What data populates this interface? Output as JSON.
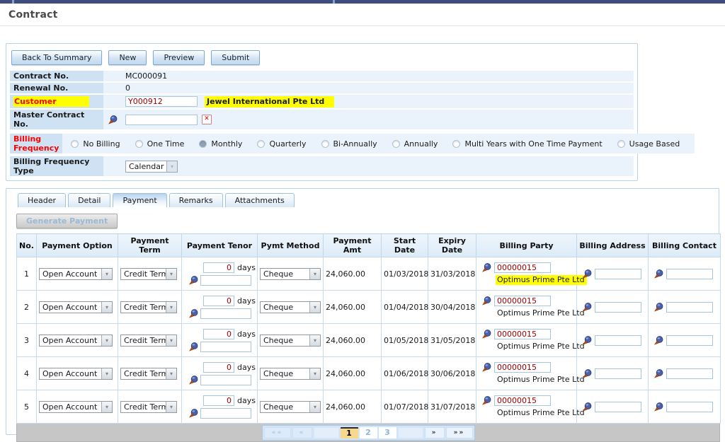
{
  "page": {
    "title": "Contract"
  },
  "toolbar": {
    "buttons": [
      {
        "label": "Back To Summary"
      },
      {
        "label": "New"
      },
      {
        "label": "Preview"
      },
      {
        "label": "Submit"
      }
    ]
  },
  "form": {
    "contract_no": {
      "label": "Contract No.",
      "value": "MC000091"
    },
    "renewal_no": {
      "label": "Renewal No.",
      "value": "0"
    },
    "customer": {
      "label": "Customer",
      "code": "Y000912",
      "name": "Jewel International Pte Ltd"
    },
    "master_contract_no": {
      "label": "Master Contract No.",
      "value": "",
      "clear_glyph": "✕"
    },
    "billing_frequency": {
      "label": "Billing Frequency",
      "selected": "Monthly",
      "options": [
        {
          "label": "No Billing"
        },
        {
          "label": "One Time"
        },
        {
          "label": "Monthly",
          "checked": true
        },
        {
          "label": "Quarterly"
        },
        {
          "label": "Bi-Annually"
        },
        {
          "label": "Annually"
        },
        {
          "label": "Multi Years with One Time Payment"
        },
        {
          "label": "Usage Based"
        }
      ]
    },
    "billing_frequency_type": {
      "label": "Billing Frequency Type",
      "value": "Calendar"
    }
  },
  "tabs": [
    {
      "label": "Header"
    },
    {
      "label": "Detail"
    },
    {
      "label": "Payment",
      "active": true
    },
    {
      "label": "Remarks"
    },
    {
      "label": "Attachments"
    }
  ],
  "payment_tab": {
    "generate_button": "Generate Payment"
  },
  "table": {
    "columns": [
      {
        "label": "No."
      },
      {
        "label": "Payment Option"
      },
      {
        "label": "Payment Term"
      },
      {
        "label": "Payment Tenor"
      },
      {
        "label": "Pymt Method"
      },
      {
        "label": "Payment Amt"
      },
      {
        "label": "Start Date"
      },
      {
        "label": "Expiry Date"
      },
      {
        "label": "Billing Party"
      },
      {
        "label": "Billing Address"
      },
      {
        "label": "Billing Contact"
      }
    ],
    "tenor_unit": "days",
    "rows": [
      {
        "no": "1",
        "payment_option": "Open Account",
        "payment_term": "Credit Term",
        "tenor_days": "0",
        "pymt_method": "Cheque",
        "payment_amt": "24,060.00",
        "start_date": "01/03/2018",
        "expiry_date": "31/03/2018",
        "billing_party_code": "00000015",
        "billing_party_name": "Optimus Prime Pte Ltd",
        "party_highlight": true
      },
      {
        "no": "2",
        "payment_option": "Open Account",
        "payment_term": "Credit Term",
        "tenor_days": "0",
        "pymt_method": "Cheque",
        "payment_amt": "24,060.00",
        "start_date": "01/04/2018",
        "expiry_date": "30/04/2018",
        "billing_party_code": "00000015",
        "billing_party_name": "Optimus Prime Pte Ltd",
        "party_highlight": false
      },
      {
        "no": "3",
        "payment_option": "Open Account",
        "payment_term": "Credit Term",
        "tenor_days": "0",
        "pymt_method": "Cheque",
        "payment_amt": "24,060.00",
        "start_date": "01/05/2018",
        "expiry_date": "31/05/2018",
        "billing_party_code": "00000015",
        "billing_party_name": "Optimus Prime Pte Ltd",
        "party_highlight": false
      },
      {
        "no": "4",
        "payment_option": "Open Account",
        "payment_term": "Credit Term",
        "tenor_days": "0",
        "pymt_method": "Cheque",
        "payment_amt": "24,060.00",
        "start_date": "01/06/2018",
        "expiry_date": "30/06/2018",
        "billing_party_code": "00000015",
        "billing_party_name": "Optimus Prime Pte Ltd",
        "party_highlight": false
      },
      {
        "no": "5",
        "payment_option": "Open Account",
        "payment_term": "Credit Term",
        "tenor_days": "0",
        "pymt_method": "Cheque",
        "payment_amt": "24,060.00",
        "start_date": "01/07/2018",
        "expiry_date": "31/07/2018",
        "billing_party_code": "00000015",
        "billing_party_name": "Optimus Prime Pte Ltd",
        "party_highlight": false
      }
    ]
  },
  "pagination": {
    "first": "««",
    "prev": "«",
    "pages": [
      {
        "label": "1",
        "current": true
      },
      {
        "label": "2",
        "current": false
      },
      {
        "label": "3",
        "current": false
      }
    ],
    "next": "»",
    "last": "»»"
  },
  "colors": {
    "highlight_yellow": "#ffff00",
    "value_red": "#a00000",
    "label_red": "#ff0000",
    "panel_border": "#b9d3ea",
    "label_bg": "#cfe2f4",
    "topbar_navy": "#3e4d80"
  }
}
